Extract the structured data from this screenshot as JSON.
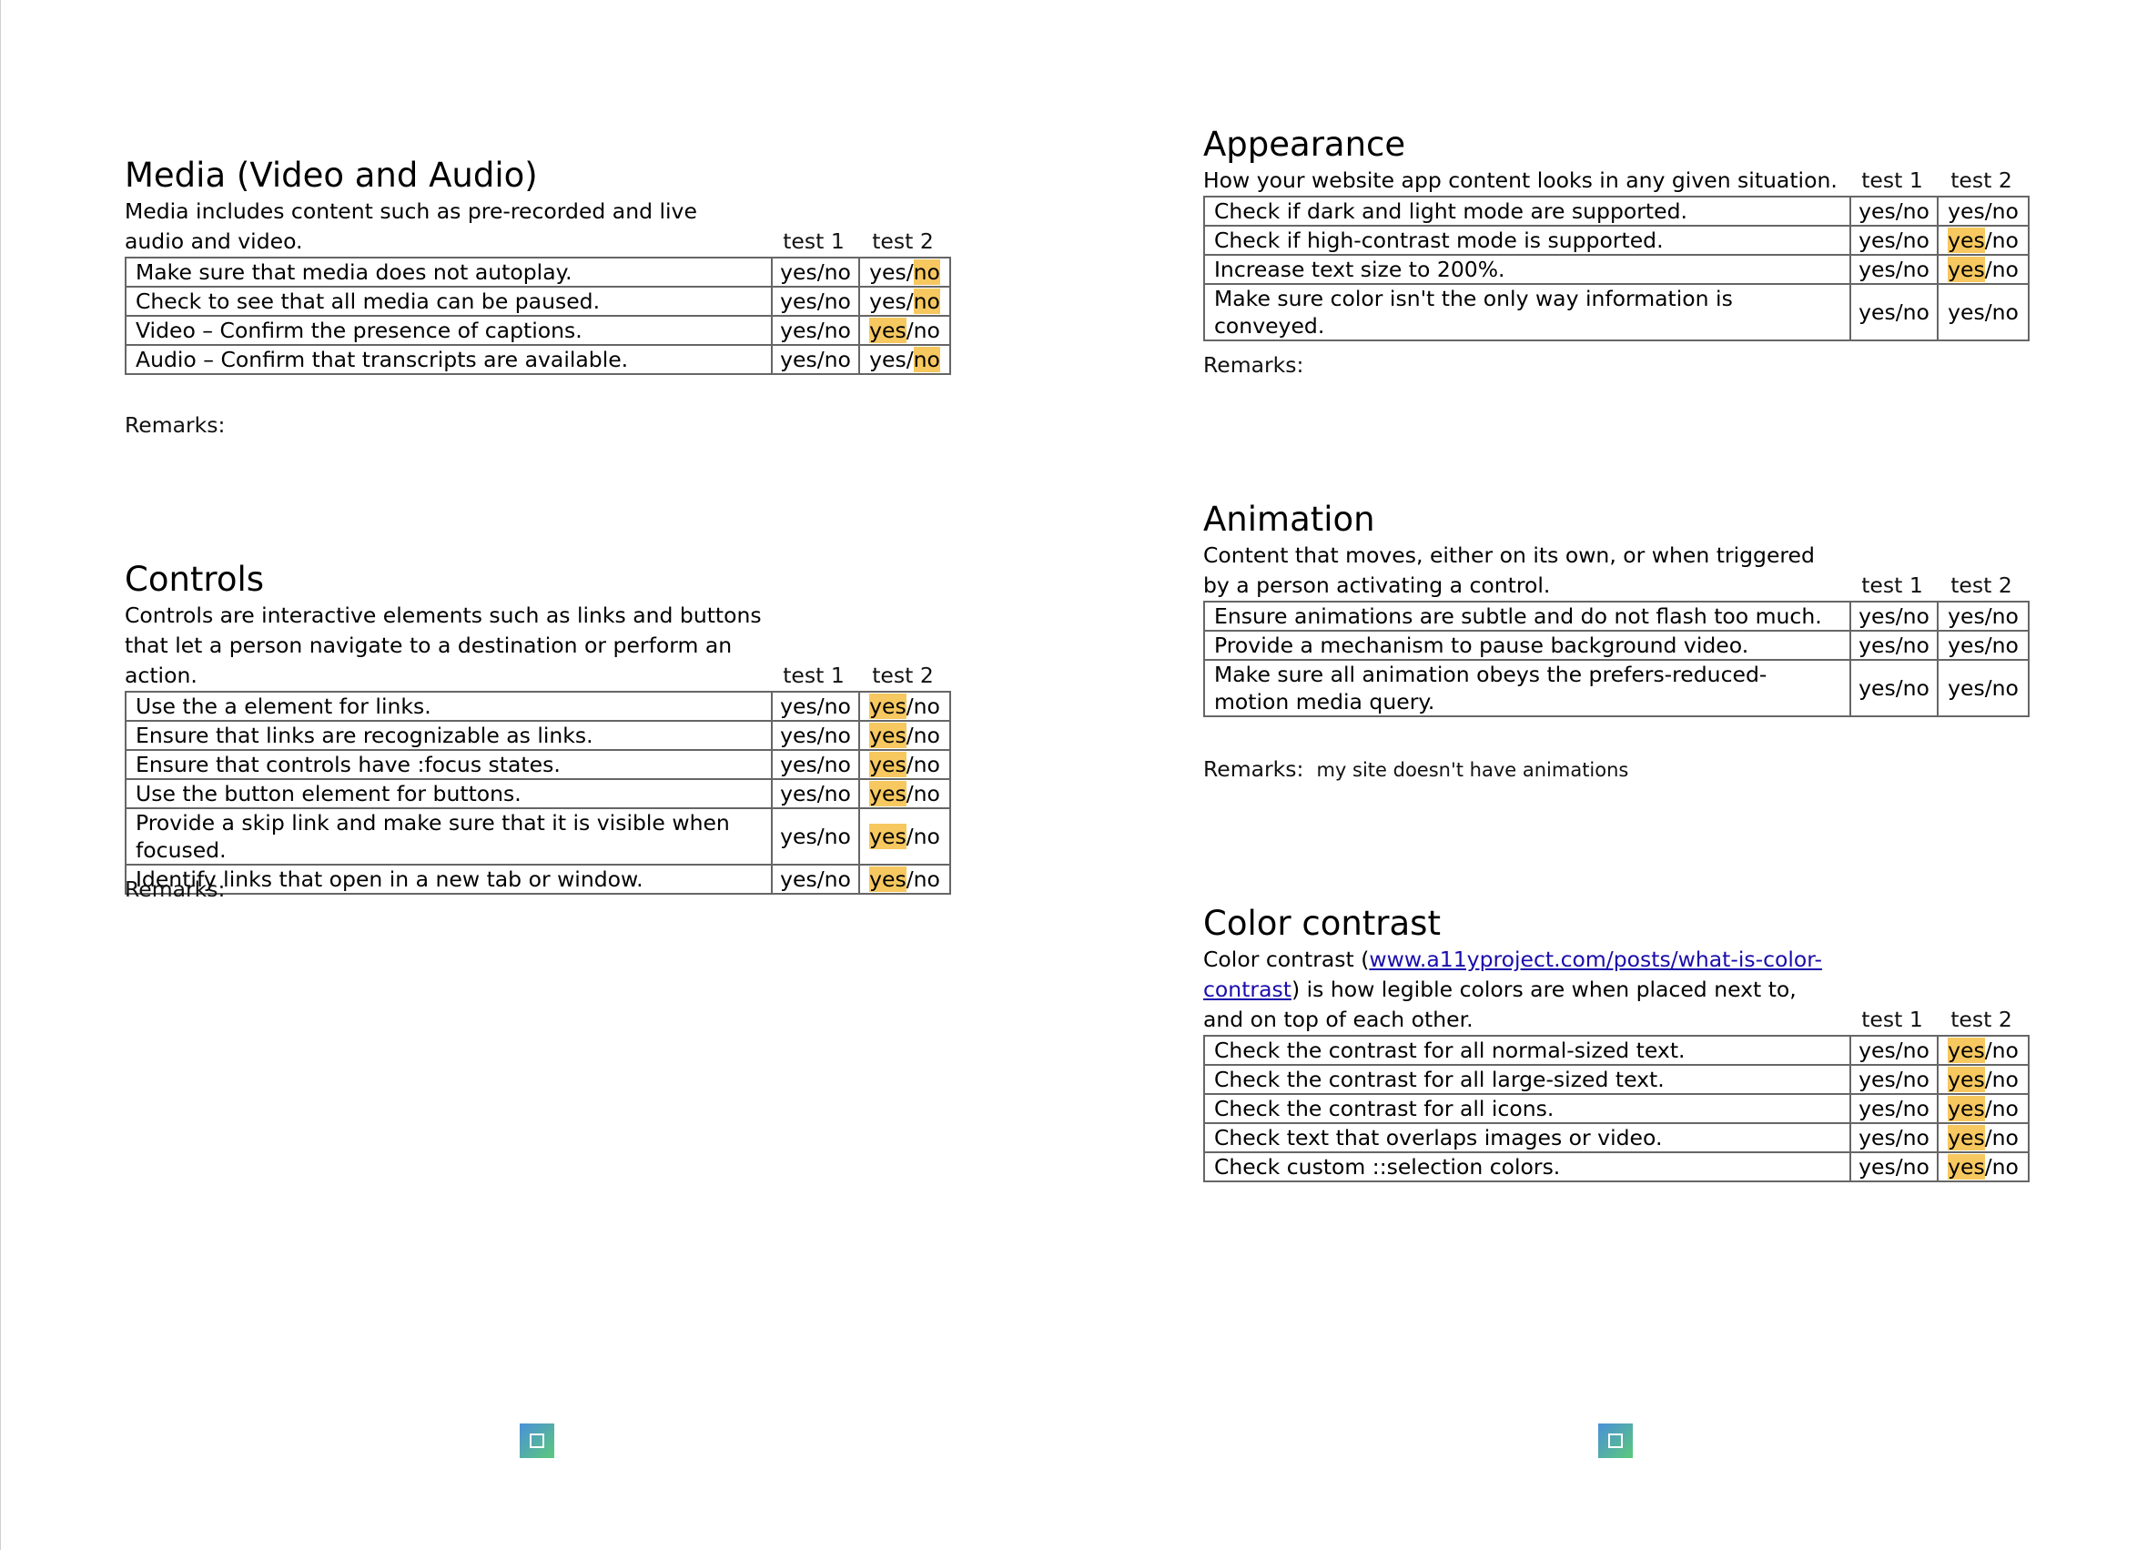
{
  "colors": {
    "highlight": "#f6c85f",
    "link": "#1a0dab",
    "table_border": "#666666"
  },
  "col_heads": {
    "test1": "test 1",
    "test2": "test 2"
  },
  "sections": {
    "media": {
      "title": "Media (Video and Audio)",
      "desc": "Media includes content such as pre-recorded and live audio and video.",
      "rows": [
        {
          "check": "Make sure that media does not autoplay.",
          "t1": "yes/no",
          "t2": "yes/no",
          "hl": "no"
        },
        {
          "check": "Check to see that all media can be paused.",
          "t1": "yes/no",
          "t2": "yes/no",
          "hl": "no"
        },
        {
          "check": "Video – Confirm the presence of captions.",
          "t1": "yes/no",
          "t2": "yes/no",
          "hl": "yes"
        },
        {
          "check": "Audio – Confirm that transcripts are available.",
          "t1": "yes/no",
          "t2": "yes/no",
          "hl": "no"
        }
      ],
      "remarks_label": "Remarks:",
      "remarks_text": ""
    },
    "controls": {
      "title": "Controls",
      "desc": "Controls are interactive elements such as links and buttons that let a person navigate to a destination or perform an action.",
      "rows": [
        {
          "check": "Use the a element for links.",
          "t1": "yes/no",
          "t2": "yes/no",
          "hl": "yes"
        },
        {
          "check": "Ensure that links are recognizable as links.",
          "t1": "yes/no",
          "t2": "yes/no",
          "hl": "yes"
        },
        {
          "check": "Ensure that controls have :focus states.",
          "t1": "yes/no",
          "t2": "yes/no",
          "hl": "yes"
        },
        {
          "check": "Use the button element for buttons.",
          "t1": "yes/no",
          "t2": "yes/no",
          "hl": "yes"
        },
        {
          "check": "Provide a skip link and make sure that it is visible when focused.",
          "t1": "yes/no",
          "t2": "yes/no",
          "hl": "yes"
        },
        {
          "check": "Identify links that open in a new tab or window.",
          "t1": "yes/no",
          "t2": "yes/no",
          "hl": "yes"
        }
      ],
      "remarks_label": "Remarks:",
      "remarks_text": ""
    },
    "appearance": {
      "title": "Appearance",
      "desc": "How your website app content looks in any given situation.",
      "rows": [
        {
          "check": "Check if dark and light mode are supported.",
          "t1": "yes/no",
          "t2": "yes/no",
          "hl": ""
        },
        {
          "check": "Check if high-contrast mode is supported.",
          "t1": "yes/no",
          "t2": "yes/no",
          "hl": "yes"
        },
        {
          "check": "Increase text size to 200%.",
          "t1": "yes/no",
          "t2": "yes/no",
          "hl": "yes"
        },
        {
          "check": "Make sure color isn't the only way information is conveyed.",
          "t1": "yes/no",
          "t2": "yes/no",
          "hl": ""
        }
      ],
      "remarks_label": "Remarks:",
      "remarks_text": ""
    },
    "animation": {
      "title": "Animation",
      "desc": "Content that moves, either on its own, or when triggered by a person activating a control.",
      "rows": [
        {
          "check": "Ensure animations are subtle and do not flash too much.",
          "t1": "yes/no",
          "t2": "yes/no",
          "hl": ""
        },
        {
          "check": "Provide a mechanism to pause background video.",
          "t1": "yes/no",
          "t2": "yes/no",
          "hl": ""
        },
        {
          "check": "Make sure all animation obeys the prefers-reduced-motion media query.",
          "t1": "yes/no",
          "t2": "yes/no",
          "hl": ""
        }
      ],
      "remarks_label": "Remarks:",
      "remarks_text": "my site doesn't have animations"
    },
    "contrast": {
      "title": "Color contrast",
      "desc_before": "Color contrast (",
      "desc_link": "www.a11yproject.com/posts/what-is-color-contrast",
      "desc_after": ") is how legible colors are when placed next to, and on top of each other.",
      "rows": [
        {
          "check": "Check the contrast for all normal-sized text.",
          "t1": "yes/no",
          "t2": "yes/no",
          "hl": "yes"
        },
        {
          "check": "Check the contrast for all large-sized text.",
          "t1": "yes/no",
          "t2": "yes/no",
          "hl": "yes"
        },
        {
          "check": "Check the contrast for all icons.",
          "t1": "yes/no",
          "t2": "yes/no",
          "hl": "yes"
        },
        {
          "check": "Check text that overlaps images or video.",
          "t1": "yes/no",
          "t2": "yes/no",
          "hl": "yes"
        },
        {
          "check": "Check custom ::selection colors.",
          "t1": "yes/no",
          "t2": "yes/no",
          "hl": "yes"
        }
      ]
    }
  }
}
